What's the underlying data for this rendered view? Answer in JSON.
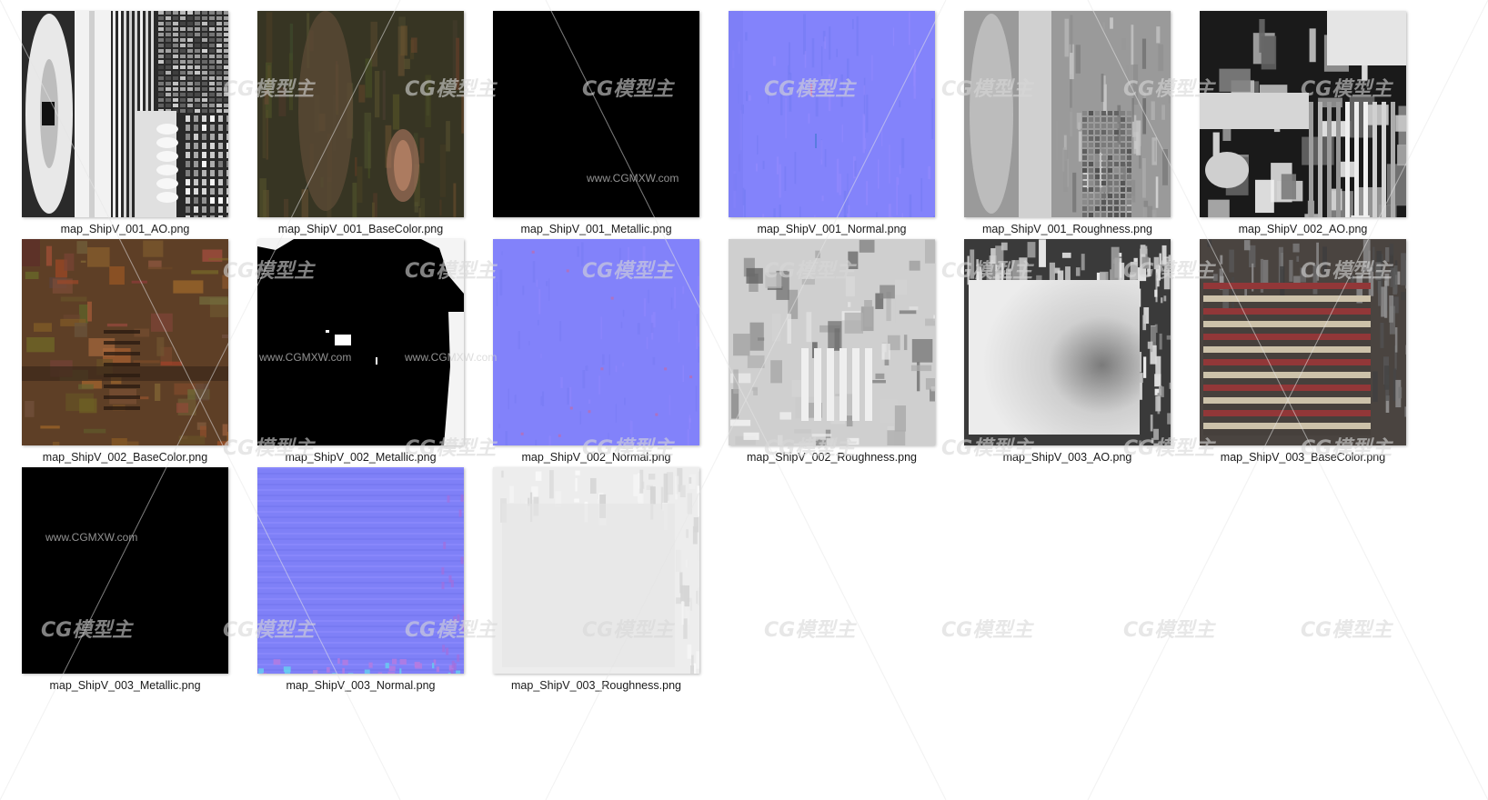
{
  "files": [
    {
      "name": "map_ShipV_001_AO.png",
      "type": "ao1"
    },
    {
      "name": "map_ShipV_001_BaseColor.png",
      "type": "base1"
    },
    {
      "name": "map_ShipV_001_Metallic.png",
      "type": "metal-black"
    },
    {
      "name": "map_ShipV_001_Normal.png",
      "type": "normal1"
    },
    {
      "name": "map_ShipV_001_Roughness.png",
      "type": "rough1"
    },
    {
      "name": "map_ShipV_002_AO.png",
      "type": "ao2"
    },
    {
      "name": "map_ShipV_002_BaseColor.png",
      "type": "base2"
    },
    {
      "name": "map_ShipV_002_Metallic.png",
      "type": "metal2"
    },
    {
      "name": "map_ShipV_002_Normal.png",
      "type": "normal2"
    },
    {
      "name": "map_ShipV_002_Roughness.png",
      "type": "rough2"
    },
    {
      "name": "map_ShipV_003_AO.png",
      "type": "ao3"
    },
    {
      "name": "map_ShipV_003_BaseColor.png",
      "type": "base3"
    },
    {
      "name": "map_ShipV_003_Metallic.png",
      "type": "metal-black"
    },
    {
      "name": "map_ShipV_003_Normal.png",
      "type": "normal3"
    },
    {
      "name": "map_ShipV_003_Roughness.png",
      "type": "rough3"
    }
  ],
  "watermark": {
    "logo": "CG模型主",
    "site": "www.CGMXW.com"
  },
  "colors": {
    "normal_blue": "#8080ff",
    "metal_black": "#000000",
    "flag_red": "#9a3a3c",
    "flag_cream": "#d9cdb4",
    "wood": "#6e4a2e"
  }
}
